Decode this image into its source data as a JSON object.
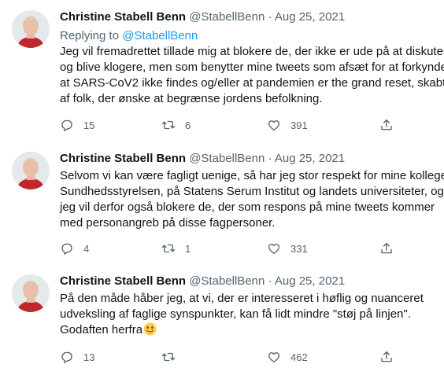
{
  "colors": {
    "text": "#0f1419",
    "secondary": "#536471",
    "link": "#1d9bf0",
    "emoji": "#ffcc4d"
  },
  "icons": {
    "reply": "reply-icon",
    "retweet": "retweet-icon",
    "like": "heart-icon",
    "share": "share-icon",
    "emoji": "slightly-smiling-face-icon"
  },
  "tweets": [
    {
      "name": "Christine Stabell Benn",
      "handle": "@StabellBenn",
      "dot": "·",
      "date": "Aug 25, 2021",
      "replying_prefix": "Replying to ",
      "replying_to": "@StabellBenn",
      "lines": [
        "Jeg vil fremadrettet tillade mig at blokere de, der ikke er ude på at diskutere",
        "og blive klogere, men som benytter mine tweets som afsæt for at forkynde",
        "at SARS-CoV2 ikke findes og/eller at pandemien er the grand reset, skabt",
        "af folk, der ønske at begrænse jordens befolkning."
      ],
      "replies": "15",
      "retweets": "6",
      "likes": "391"
    },
    {
      "name": "Christine Stabell Benn",
      "handle": "@StabellBenn",
      "dot": "·",
      "date": "Aug 25, 2021",
      "lines": [
        "Selvom vi kan være fagligt uenige, så har jeg stor respekt for mine kolleger i",
        "Sundhedsstyrelsen, på Statens Serum Institut og landets universiteter, og",
        "jeg vil derfor også blokere de, der som respons på mine tweets kommer",
        "med personangreb på disse fagpersoner."
      ],
      "replies": "4",
      "retweets": "1",
      "likes": "331"
    },
    {
      "name": "Christine Stabell Benn",
      "handle": "@StabellBenn",
      "dot": "·",
      "date": "Aug 25, 2021",
      "lines": [
        "På den måde håber jeg, at vi, der er interesseret i høflig og nuanceret",
        "udveksling af faglige synspunkter, kan få lidt mindre \"støj på linjen\".",
        "Godaften herfra"
      ],
      "replies": "13",
      "retweets": "",
      "likes": "462"
    }
  ]
}
